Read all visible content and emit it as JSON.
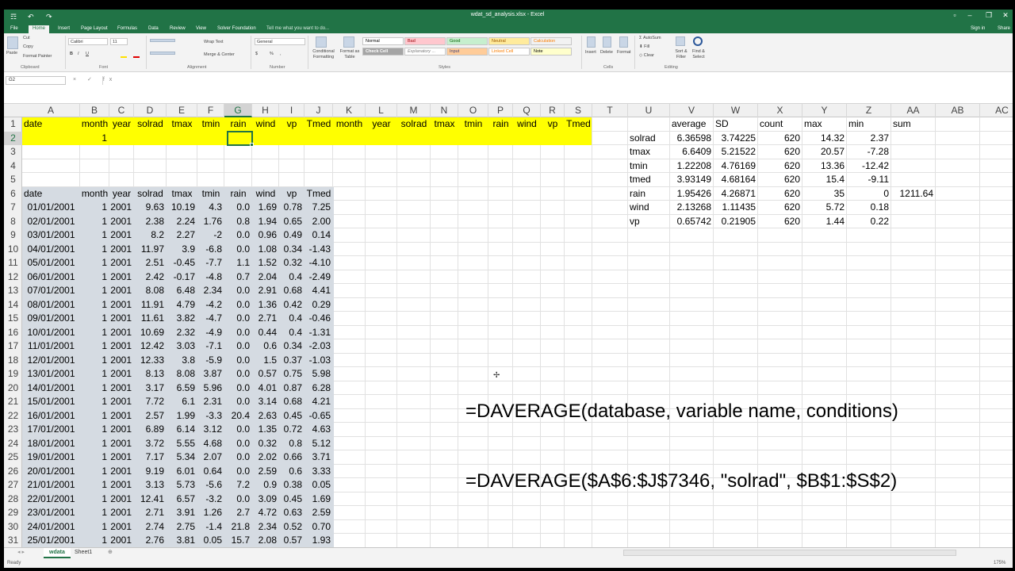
{
  "window": {
    "title": "wdat_sd_analysis.xlsx - Excel",
    "sign_in": "Sign in",
    "share": "Share"
  },
  "qat": {
    "save": "☶",
    "undo": "↶",
    "redo": "↷"
  },
  "tabs": [
    "File",
    "Home",
    "Insert",
    "Page Layout",
    "Formulas",
    "Data",
    "Review",
    "View",
    "Solver Foundation"
  ],
  "tell_me": "Tell me what you want to do...",
  "ribbon": {
    "clipboard": {
      "paste": "Paste",
      "cut": "Cut",
      "copy": "Copy",
      "format_painter": "Format Painter",
      "group": "Clipboard"
    },
    "font": {
      "name": "Calibri",
      "size": "11",
      "group": "Font",
      "bold": "B",
      "italic": "I",
      "underline": "U"
    },
    "alignment": {
      "wrap": "Wrap Text",
      "merge": "Merge & Center",
      "group": "Alignment"
    },
    "number": {
      "format": "General",
      "group": "Number",
      "currency": "$",
      "percent": "%",
      "comma": ","
    },
    "styles": {
      "conditional": "Conditional Formatting",
      "format_table": "Format as Table",
      "normal": "Normal",
      "bad": "Bad",
      "good": "Good",
      "neutral": "Neutral",
      "calculation": "Calculation",
      "check_cell": "Check Cell",
      "explanatory": "Explanatory ...",
      "input": "Input",
      "linked_cell": "Linked Cell",
      "note": "Note",
      "group": "Styles"
    },
    "cells": {
      "insert": "Insert",
      "delete": "Delete",
      "format": "Format",
      "group": "Cells"
    },
    "editing": {
      "autosum": "AutoSum",
      "fill": "Fill",
      "clear": "Clear",
      "sort_filter": "Sort & Filter",
      "find_select": "Find & Select",
      "group": "Editing"
    }
  },
  "namebox": "G2",
  "fx_icons": "× ✓ fx",
  "columns": [
    "A",
    "B",
    "C",
    "D",
    "E",
    "F",
    "G",
    "H",
    "I",
    "J",
    "K",
    "L",
    "M",
    "N",
    "O",
    "P",
    "Q",
    "R",
    "S",
    "T",
    "U",
    "V",
    "W",
    "X",
    "Y",
    "Z",
    "AA",
    "AB",
    "AC"
  ],
  "rows": [
    "1",
    "2",
    "3",
    "4",
    "5",
    "6",
    "7",
    "8",
    "9",
    "10",
    "11",
    "12",
    "13",
    "14",
    "15",
    "16",
    "17",
    "18",
    "19",
    "20",
    "21",
    "22",
    "23",
    "24",
    "25",
    "26",
    "27",
    "28",
    "29",
    "30",
    "31"
  ],
  "criteria": {
    "headers": [
      "date",
      "month",
      "year",
      "solrad",
      "tmax",
      "tmin",
      "rain",
      "wind",
      "vp",
      "Tmed",
      "month",
      "year",
      "solrad",
      "tmax",
      "tmin",
      "rain",
      "wind",
      "vp",
      "Tmed"
    ],
    "month_value": "1"
  },
  "database": {
    "headers": [
      "date",
      "month",
      "year",
      "solrad",
      "tmax",
      "tmin",
      "rain",
      "wind",
      "vp",
      "Tmed"
    ],
    "rows": [
      [
        "01/01/2001",
        "1",
        "2001",
        "9.63",
        "10.19",
        "4.3",
        "0.0",
        "1.69",
        "0.78",
        "7.25"
      ],
      [
        "02/01/2001",
        "1",
        "2001",
        "2.38",
        "2.24",
        "1.76",
        "0.8",
        "1.94",
        "0.65",
        "2.00"
      ],
      [
        "03/01/2001",
        "1",
        "2001",
        "8.2",
        "2.27",
        "-2",
        "0.0",
        "0.96",
        "0.49",
        "0.14"
      ],
      [
        "04/01/2001",
        "1",
        "2001",
        "11.97",
        "3.9",
        "-6.8",
        "0.0",
        "1.08",
        "0.34",
        "-1.43"
      ],
      [
        "05/01/2001",
        "1",
        "2001",
        "2.51",
        "-0.45",
        "-7.7",
        "1.1",
        "1.52",
        "0.32",
        "-4.10"
      ],
      [
        "06/01/2001",
        "1",
        "2001",
        "2.42",
        "-0.17",
        "-4.8",
        "0.7",
        "2.04",
        "0.4",
        "-2.49"
      ],
      [
        "07/01/2001",
        "1",
        "2001",
        "8.08",
        "6.48",
        "2.34",
        "0.0",
        "2.91",
        "0.68",
        "4.41"
      ],
      [
        "08/01/2001",
        "1",
        "2001",
        "11.91",
        "4.79",
        "-4.2",
        "0.0",
        "1.36",
        "0.42",
        "0.29"
      ],
      [
        "09/01/2001",
        "1",
        "2001",
        "11.61",
        "3.82",
        "-4.7",
        "0.0",
        "2.71",
        "0.4",
        "-0.46"
      ],
      [
        "10/01/2001",
        "1",
        "2001",
        "10.69",
        "2.32",
        "-4.9",
        "0.0",
        "0.44",
        "0.4",
        "-1.31"
      ],
      [
        "11/01/2001",
        "1",
        "2001",
        "12.42",
        "3.03",
        "-7.1",
        "0.0",
        "0.6",
        "0.34",
        "-2.03"
      ],
      [
        "12/01/2001",
        "1",
        "2001",
        "12.33",
        "3.8",
        "-5.9",
        "0.0",
        "1.5",
        "0.37",
        "-1.03"
      ],
      [
        "13/01/2001",
        "1",
        "2001",
        "8.13",
        "8.08",
        "3.87",
        "0.0",
        "0.57",
        "0.75",
        "5.98"
      ],
      [
        "14/01/2001",
        "1",
        "2001",
        "3.17",
        "6.59",
        "5.96",
        "0.0",
        "4.01",
        "0.87",
        "6.28"
      ],
      [
        "15/01/2001",
        "1",
        "2001",
        "7.72",
        "6.1",
        "2.31",
        "0.0",
        "3.14",
        "0.68",
        "4.21"
      ],
      [
        "16/01/2001",
        "1",
        "2001",
        "2.57",
        "1.99",
        "-3.3",
        "20.4",
        "2.63",
        "0.45",
        "-0.65"
      ],
      [
        "17/01/2001",
        "1",
        "2001",
        "6.89",
        "6.14",
        "3.12",
        "0.0",
        "1.35",
        "0.72",
        "4.63"
      ],
      [
        "18/01/2001",
        "1",
        "2001",
        "3.72",
        "5.55",
        "4.68",
        "0.0",
        "0.32",
        "0.8",
        "5.12"
      ],
      [
        "19/01/2001",
        "1",
        "2001",
        "7.17",
        "5.34",
        "2.07",
        "0.0",
        "2.02",
        "0.66",
        "3.71"
      ],
      [
        "20/01/2001",
        "1",
        "2001",
        "9.19",
        "6.01",
        "0.64",
        "0.0",
        "2.59",
        "0.6",
        "3.33"
      ],
      [
        "21/01/2001",
        "1",
        "2001",
        "3.13",
        "5.73",
        "-5.6",
        "7.2",
        "0.9",
        "0.38",
        "0.05"
      ],
      [
        "22/01/2001",
        "1",
        "2001",
        "12.41",
        "6.57",
        "-3.2",
        "0.0",
        "3.09",
        "0.45",
        "1.69"
      ],
      [
        "23/01/2001",
        "1",
        "2001",
        "2.71",
        "3.91",
        "1.26",
        "2.7",
        "4.72",
        "0.63",
        "2.59"
      ],
      [
        "24/01/2001",
        "1",
        "2001",
        "2.74",
        "2.75",
        "-1.4",
        "21.8",
        "2.34",
        "0.52",
        "0.70"
      ],
      [
        "25/01/2001",
        "1",
        "2001",
        "2.76",
        "3.81",
        "0.05",
        "15.7",
        "2.08",
        "0.57",
        "1.93"
      ]
    ]
  },
  "stats": {
    "headers": [
      "average",
      "SD",
      "count",
      "max",
      "min",
      "sum"
    ],
    "rows": [
      [
        "solrad",
        "6.36598",
        "3.74225",
        "620",
        "14.32",
        "2.37",
        ""
      ],
      [
        "tmax",
        "6.6409",
        "5.21522",
        "620",
        "20.57",
        "-7.28",
        ""
      ],
      [
        "tmin",
        "1.22208",
        "4.76169",
        "620",
        "13.36",
        "-12.42",
        ""
      ],
      [
        "tmed",
        "3.93149",
        "4.68164",
        "620",
        "15.4",
        "-9.11",
        ""
      ],
      [
        "rain",
        "1.95426",
        "4.26871",
        "620",
        "35",
        "0",
        "1211.64"
      ],
      [
        "wind",
        "2.13268",
        "1.11435",
        "620",
        "5.72",
        "0.18",
        ""
      ],
      [
        "vp",
        "0.65742",
        "0.21905",
        "620",
        "1.44",
        "0.22",
        ""
      ]
    ]
  },
  "annotation": {
    "line1": "=DAVERAGE(database, variable name, conditions)",
    "line2": "=DAVERAGE($A$6:$J$7346, \"solrad\", $B$1:$S$2)"
  },
  "sheets": [
    "wdata",
    "Sheet1"
  ],
  "status": {
    "ready": "Ready",
    "zoom": "175%"
  }
}
